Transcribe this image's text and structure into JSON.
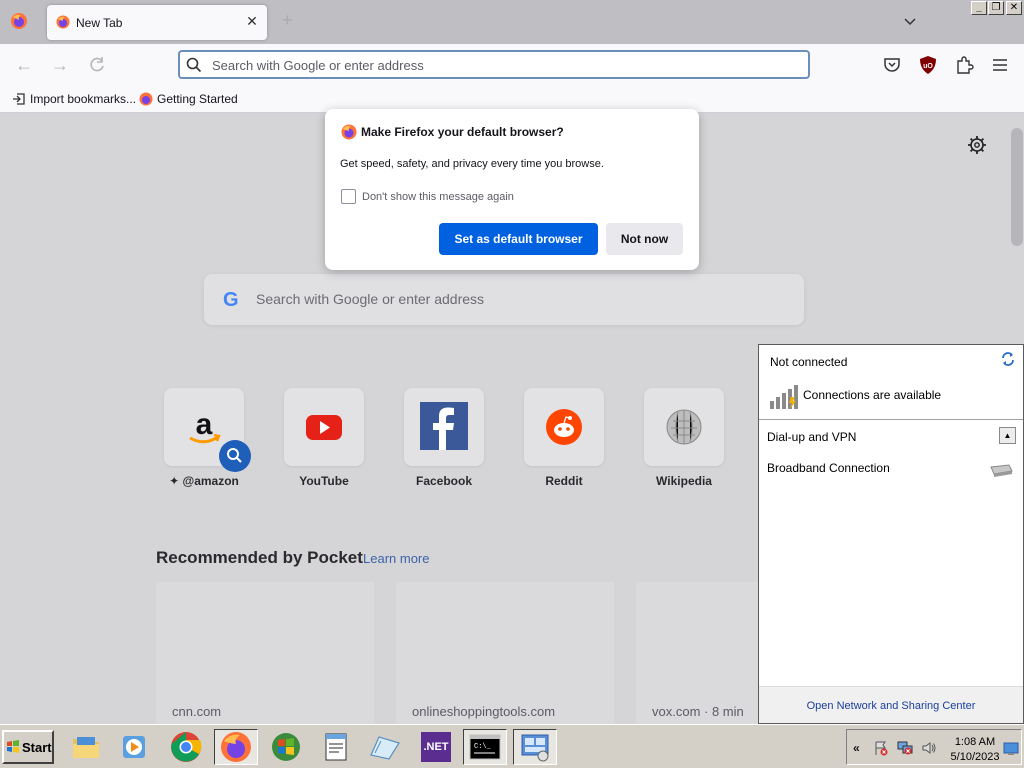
{
  "browser": {
    "tab": {
      "title": "New Tab",
      "close_glyph": "✕"
    },
    "window_controls": {
      "minimize": "_",
      "restore": "❐",
      "close": "✕"
    },
    "urlbar": {
      "placeholder": "Search with Google or enter address",
      "value": ""
    },
    "toolbar_icons": [
      "pocket-icon",
      "ublock-icon",
      "extensions-icon",
      "menu-icon"
    ],
    "bookmarks": [
      {
        "label": "Import bookmarks...",
        "icon": "import-icon"
      },
      {
        "label": "Getting Started",
        "icon": "firefox-icon"
      }
    ]
  },
  "newtab": {
    "search": {
      "placeholder": "Search with Google or enter address",
      "logo": "G"
    },
    "top_sites": [
      {
        "label": "@amazon",
        "icon": "amazon-icon"
      },
      {
        "label": "YouTube",
        "icon": "youtube-icon"
      },
      {
        "label": "Facebook",
        "icon": "facebook-icon"
      },
      {
        "label": "Reddit",
        "icon": "reddit-icon"
      },
      {
        "label": "Wikipedia",
        "icon": "wikipedia-icon"
      }
    ],
    "pocket": {
      "title": "Recommended by Pocket",
      "learn_more": "Learn more",
      "cards": [
        {
          "source": "cnn.com"
        },
        {
          "source": "onlineshoppingtools.com"
        },
        {
          "source": "vox.com · 8 min"
        }
      ]
    }
  },
  "dialog": {
    "title": "Make Firefox your default browser?",
    "body": "Get speed, safety, and privacy every time you browse.",
    "checkbox_label": "Don't show this message again",
    "checkbox_checked": false,
    "primary_button": "Set as default browser",
    "secondary_button": "Not now",
    "primary_color": "#0061e0"
  },
  "network_panel": {
    "status": "Not connected",
    "availability": "Connections are available",
    "group": "Dial-up and VPN",
    "connection": "Broadband Connection",
    "footer_link": "Open Network and Sharing Center"
  },
  "taskbar": {
    "start_label": "Start",
    "apps": [
      "explorer-icon",
      "media-player-icon",
      "chrome-icon",
      "firefox-icon",
      "windows-logo-icon",
      "notepad-icon",
      "paint-icon",
      "dotnet-icon",
      "cmd-icon",
      "control-panel-icon"
    ],
    "dotnet_label": ".NET",
    "clock": {
      "time": "1:08 AM",
      "date": "5/10/2023"
    }
  }
}
